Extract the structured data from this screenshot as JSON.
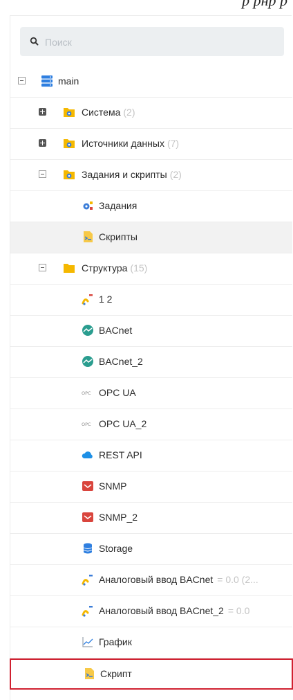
{
  "caption": "р  рнр   р",
  "search": {
    "placeholder": "Поиск"
  },
  "tree": {
    "root": {
      "label": "main"
    },
    "sistema": {
      "label": "Система",
      "count": "(2)"
    },
    "istochniki": {
      "label": "Источники данных",
      "count": "(7)"
    },
    "zadaniya_skripty": {
      "label": "Задания и скрипты",
      "count": "(2)"
    },
    "zadaniya": {
      "label": "Задания"
    },
    "skripty": {
      "label": "Скрипты"
    },
    "struktura": {
      "label": "Структура",
      "count": "(15)"
    },
    "items": [
      {
        "label": "1 2",
        "icon": "analog-input-icon"
      },
      {
        "label": "BACnet",
        "icon": "bacnet-icon"
      },
      {
        "label": "BACnet_2",
        "icon": "bacnet-icon"
      },
      {
        "label": "OPC UA",
        "icon": "opc-icon"
      },
      {
        "label": "OPC UA_2",
        "icon": "opc-icon"
      },
      {
        "label": "REST API",
        "icon": "cloud-icon"
      },
      {
        "label": "SNMP",
        "icon": "snmp-icon"
      },
      {
        "label": "SNMP_2",
        "icon": "snmp-icon"
      },
      {
        "label": "Storage",
        "icon": "database-icon"
      },
      {
        "label": "Аналоговый ввод BACnet",
        "value": "= 0.0 (2...",
        "icon": "analog-input-icon"
      },
      {
        "label": "Аналоговый ввод BACnet_2",
        "value": "= 0.0",
        "icon": "analog-input-icon"
      },
      {
        "label": "График",
        "icon": "chart-icon"
      },
      {
        "label": "Скрипт",
        "icon": "script-icon"
      }
    ]
  },
  "colors": {
    "folder": "#f5b800",
    "gear": "#3b7dd8",
    "db": "#2f7fe0",
    "bacnet": "#2a9d8f",
    "snmp": "#d9453d",
    "cloud": "#1e90e6",
    "highlight": "#d02030"
  }
}
